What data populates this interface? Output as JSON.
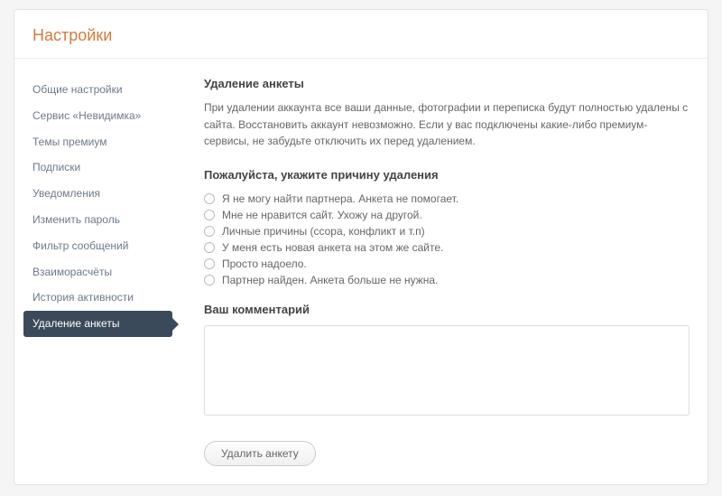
{
  "header": {
    "title": "Настройки"
  },
  "sidebar": {
    "items": [
      {
        "label": "Общие настройки",
        "active": false
      },
      {
        "label": "Сервис «Невидимка»",
        "active": false
      },
      {
        "label": "Темы премиум",
        "active": false
      },
      {
        "label": "Подписки",
        "active": false
      },
      {
        "label": "Уведомления",
        "active": false
      },
      {
        "label": "Изменить пароль",
        "active": false
      },
      {
        "label": "Фильтр сообщений",
        "active": false
      },
      {
        "label": "Взаиморасчёты",
        "active": false
      },
      {
        "label": "История активности",
        "active": false
      },
      {
        "label": "Удаление анкеты",
        "active": true
      }
    ]
  },
  "content": {
    "title": "Удаление анкеты",
    "intro": "При удалении аккаунта все ваши данные, фотографии и переписка будут полностью удалены с сайта. Восстановить аккаунт невозможно. Если у вас подключены какие-либо премиум-сервисы, не забудьте отключить их перед удалением.",
    "reason_heading": "Пожалуйста, укажите причину удаления",
    "reasons": [
      "Я не могу найти партнера. Анкета не помогает.",
      "Мне не нравится сайт. Ухожу на другой.",
      "Личные причины (ссора, конфликт и т.п)",
      "У меня есть новая анкета на этом же сайте.",
      "Просто надоело.",
      "Партнер найден. Анкета больше не нужна."
    ],
    "comment_label": "Ваш комментарий",
    "comment_value": "",
    "delete_button": "Удалить анкету"
  }
}
